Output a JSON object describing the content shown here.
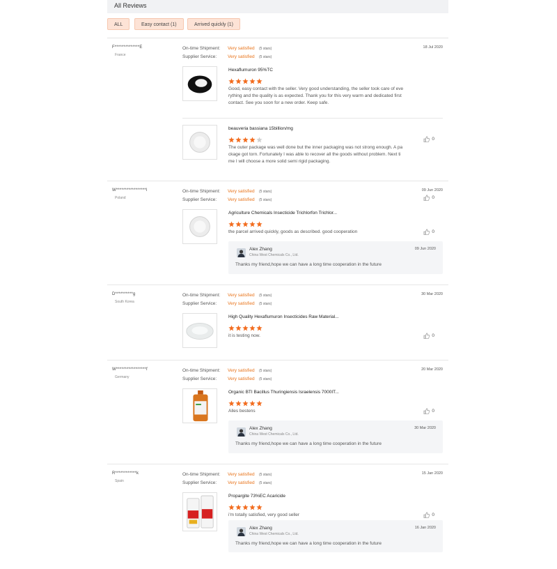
{
  "header": {
    "title": "All Reviews"
  },
  "filters": [
    {
      "label": "ALL"
    },
    {
      "label": "Easy contact (1)"
    },
    {
      "label": "Arrived quickly (1)"
    }
  ],
  "labels": {
    "shipment": "On-time Shipment:",
    "service": "Supplier Service:"
  },
  "reviews": [
    {
      "user": "F**************E",
      "country": "France",
      "shipment": "Very satisfied",
      "shipment_stars": "(5 stars)",
      "service": "Very satisfied",
      "service_stars": "(5 stars)",
      "date": "18 Jul 2020",
      "products": [
        {
          "title": "Hexaflumuron 95%TC",
          "stars": 5,
          "text": "Good, easy contact with the seller. Very good understanding, the seller took care of everything and the quality is as expected. Thank you for this very warm and dedicated first contact. See you soon for a new order. Keep safe.",
          "likes": "0",
          "img": "black-powder"
        },
        {
          "title": "beauveria bassiana 15billion/mg",
          "stars": 4,
          "text": "The outer package was well done but the inner packaging was not strong enough. A package got torn. Fortunately I was able to recover all the goods without problem. Next time I will choose a more solid semi rigid packaging.",
          "likes": "0",
          "img": "white-powder"
        }
      ]
    },
    {
      "user": "W*****************l",
      "country": "Poland",
      "shipment": "Very satisfied",
      "shipment_stars": "(5 stars)",
      "service": "Very satisfied",
      "service_stars": "(5 stars)",
      "date": "09 Jun 2020",
      "products": [
        {
          "title": "Agriculture Chemicals Insecticide Trichlorfon Trichlor...",
          "stars": 5,
          "text": "the parcel arrived quickly, goods as described. good cooperation",
          "likes": "0",
          "img": "white-powder"
        }
      ],
      "reply": {
        "name": "Alex Zhang",
        "company": "China West Chemicals Co., Ltd.",
        "date": "09 Jun 2020",
        "text": "Thanks my friend,hope we can have a long time cooperation in the future"
      }
    },
    {
      "user": "D**********g",
      "country": "South Korea",
      "shipment": "Very satisfied",
      "shipment_stars": "(5 stars)",
      "service": "Very satisfied",
      "service_stars": "(5 stars)",
      "date": "30 Mar 2020",
      "products": [
        {
          "title": "High Quality Hexaflumuron Insecticides Raw Material...",
          "stars": 5,
          "text": "it is testing now.",
          "likes": "0",
          "img": "white-dish"
        }
      ]
    },
    {
      "user": "W*****************f",
      "country": "Germany",
      "shipment": "Very satisfied",
      "shipment_stars": "(5 stars)",
      "service": "Very satisfied",
      "service_stars": "(5 stars)",
      "date": "20 Mar 2020",
      "products": [
        {
          "title": "Organic BTI Bacillus Thuringiensis Israelensis 7000IT...",
          "stars": 5,
          "text": "Alles bestens",
          "likes": "0",
          "img": "bottle"
        }
      ],
      "reply": {
        "name": "Alex Zhang",
        "company": "China West Chemicals Co., Ltd.",
        "date": "30 Mar 2020",
        "text": "Thanks my friend,hope we can have a long time cooperation in the future"
      }
    },
    {
      "user": "R************k",
      "country": "Spain",
      "shipment": "Very satisfied",
      "shipment_stars": "(5 stars)",
      "service": "Very satisfied",
      "service_stars": "(5 stars)",
      "date": "15 Jan 2020",
      "products": [
        {
          "title": "Propargite 73%EC Acaricide",
          "stars": 5,
          "text": "i'm totally satisfied, very good seller",
          "likes": "0",
          "img": "bottles"
        }
      ],
      "reply": {
        "name": "Alex Zhang",
        "company": "China West Chemicals Co., Ltd.",
        "date": "16 Jan 2020",
        "text": "Thanks my friend,hope we can have a long time cooperation in the future"
      }
    }
  ],
  "colors": {
    "accent": "#e8731a",
    "star_on": "#f26b1d",
    "star_off": "#cfcfcf",
    "filter_bg": "#fde3d6"
  }
}
